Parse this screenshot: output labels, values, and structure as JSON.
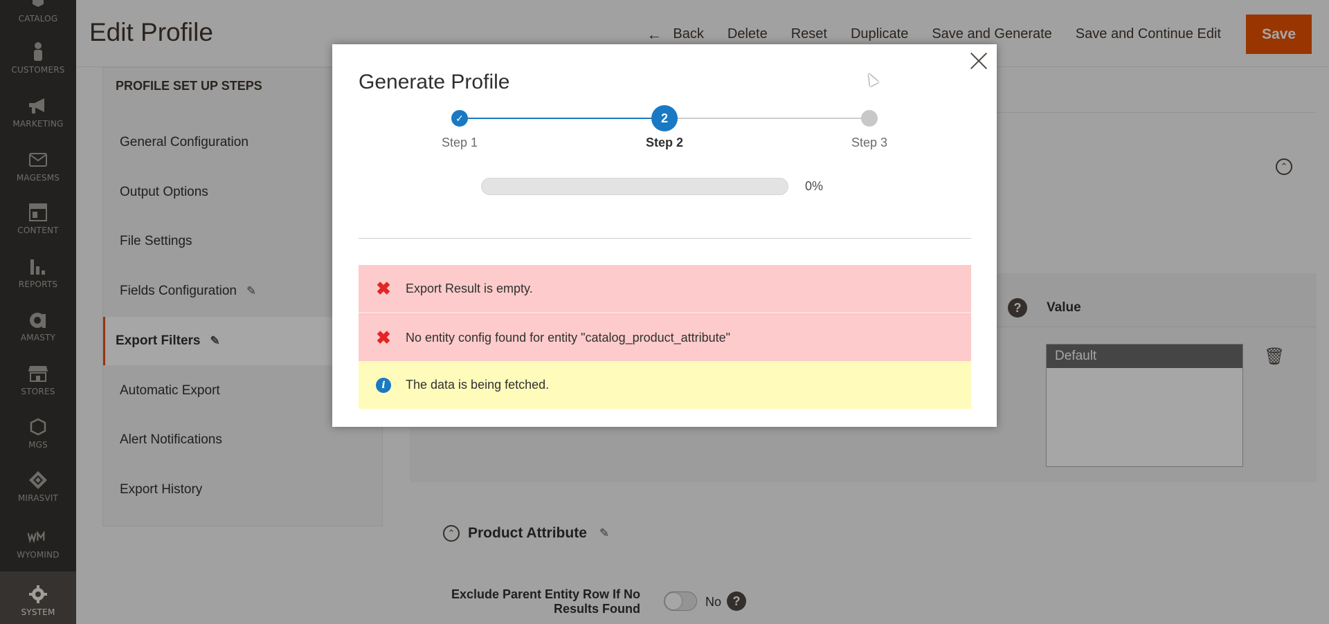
{
  "admin_nav": [
    {
      "label": "CATALOG",
      "icon": "box-icon"
    },
    {
      "label": "CUSTOMERS",
      "icon": "person-icon"
    },
    {
      "label": "MARKETING",
      "icon": "megaphone-icon"
    },
    {
      "label": "MAGESMS",
      "icon": "envelope-icon"
    },
    {
      "label": "CONTENT",
      "icon": "layout-icon"
    },
    {
      "label": "REPORTS",
      "icon": "bar-chart-icon"
    },
    {
      "label": "AMASTY",
      "icon": "amasty-logo-icon"
    },
    {
      "label": "STORES",
      "icon": "store-icon"
    },
    {
      "label": "MGS",
      "icon": "hexagon-icon"
    },
    {
      "label": "MIRASVIT",
      "icon": "mirasvit-logo-icon"
    },
    {
      "label": "WYOMIND",
      "icon": "wyomind-logo-icon"
    },
    {
      "label": "SYSTEM",
      "icon": "gear-icon"
    }
  ],
  "header": {
    "title": "Edit Profile",
    "actions": {
      "back": "Back",
      "delete": "Delete",
      "reset": "Reset",
      "duplicate": "Duplicate",
      "save_generate": "Save and Generate",
      "save_continue": "Save and Continue Edit",
      "save": "Save"
    },
    "accent_color": "#eb5202"
  },
  "steps_panel": {
    "heading": "PROFILE SET UP STEPS",
    "items": [
      {
        "label": "General Configuration"
      },
      {
        "label": "Output Options"
      },
      {
        "label": "File Settings"
      },
      {
        "label": "Fields Configuration"
      },
      {
        "label": "Export Filters"
      },
      {
        "label": "Automatic Export"
      },
      {
        "label": "Alert Notifications"
      },
      {
        "label": "Export History"
      }
    ],
    "active": "Export Filters"
  },
  "main": {
    "grid_value_label": "Value",
    "store_option": "Default",
    "section_title": "Product Attribute",
    "exclude_label": "Exclude Parent Entity Row If No Results Found",
    "toggle_value": "No"
  },
  "modal": {
    "title": "Generate Profile",
    "steps": [
      "Step 1",
      "Step 2",
      "Step 3"
    ],
    "current_step_number": "2",
    "current_step_index": 2,
    "progress_value": 0,
    "progress_text": "0%",
    "messages": [
      {
        "type": "error",
        "text": "Export Result is empty."
      },
      {
        "type": "error",
        "text": "No entity config found for entity \"catalog_product_attribute\""
      },
      {
        "type": "notice",
        "text": "The data is being fetched."
      }
    ],
    "colors": {
      "primary": "#1979c3",
      "error_bg": "#fdcbcb",
      "notice_bg": "#fffbbb",
      "error_icon": "#e22626"
    }
  }
}
